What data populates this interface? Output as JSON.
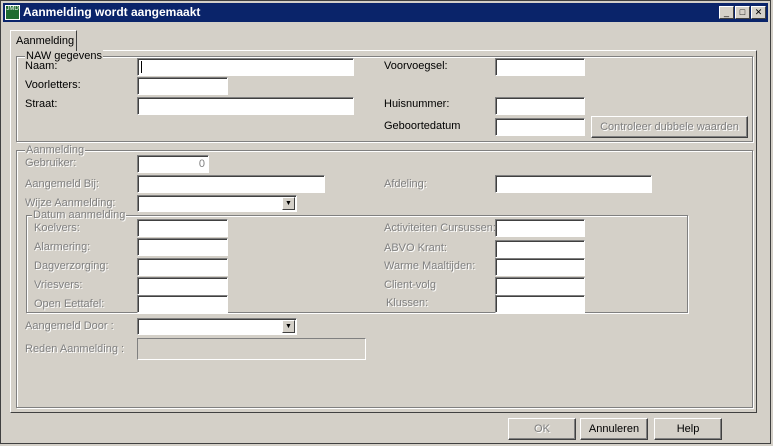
{
  "window": {
    "title": "Aanmelding wordt aangemaakt",
    "app_icon_text": "JMD",
    "minimize_glyph": "_",
    "maximize_glyph": "□",
    "close_glyph": "✕"
  },
  "tabs": [
    {
      "label": "Aanmelding",
      "active": true
    }
  ],
  "naw": {
    "legend": "NAW gegevens",
    "naam_label": "Naam:",
    "naam_value": "",
    "voorletters_label": "Voorletters:",
    "voorletters_value": "",
    "straat_label": "Straat:",
    "straat_value": "",
    "voorvoegsel_label": "Voorvoegsel:",
    "voorvoegsel_value": "",
    "huisnummer_label": "Huisnummer:",
    "huisnummer_value": "",
    "geboortedatum_label": "Geboortedatum",
    "geboortedatum_value": "",
    "controleer_button": "Controleer dubbele waarden"
  },
  "aanmelding": {
    "legend": "Aanmelding",
    "gebruiker_label": "Gebruiker:",
    "gebruiker_value": "0",
    "aangemeld_bij_label": "Aangemeld Bij:",
    "afdeling_label": "Afdeling:",
    "wijze_label": "Wijze Aanmelding:",
    "aangemeld_door_label": "Aangemeld Door :",
    "reden_label": "Reden Aanmelding :"
  },
  "datum": {
    "legend": "Datum aanmelding",
    "left": [
      "Koelvers:",
      "Alarmering:",
      "Dagverzorging:",
      "Vriesvers:",
      "Open Eettafel:"
    ],
    "right": [
      "Activiteiten Cursussen:",
      "ABVO Krant:",
      "Warme Maaltijden:",
      "Client-volg",
      "Klussen:"
    ]
  },
  "footer": {
    "ok": "OK",
    "annuleren": "Annuleren",
    "help": "Help"
  },
  "colors": {
    "titlebar": "#0a246a",
    "face": "#d4d0c8",
    "disabled_text": "#808080"
  }
}
